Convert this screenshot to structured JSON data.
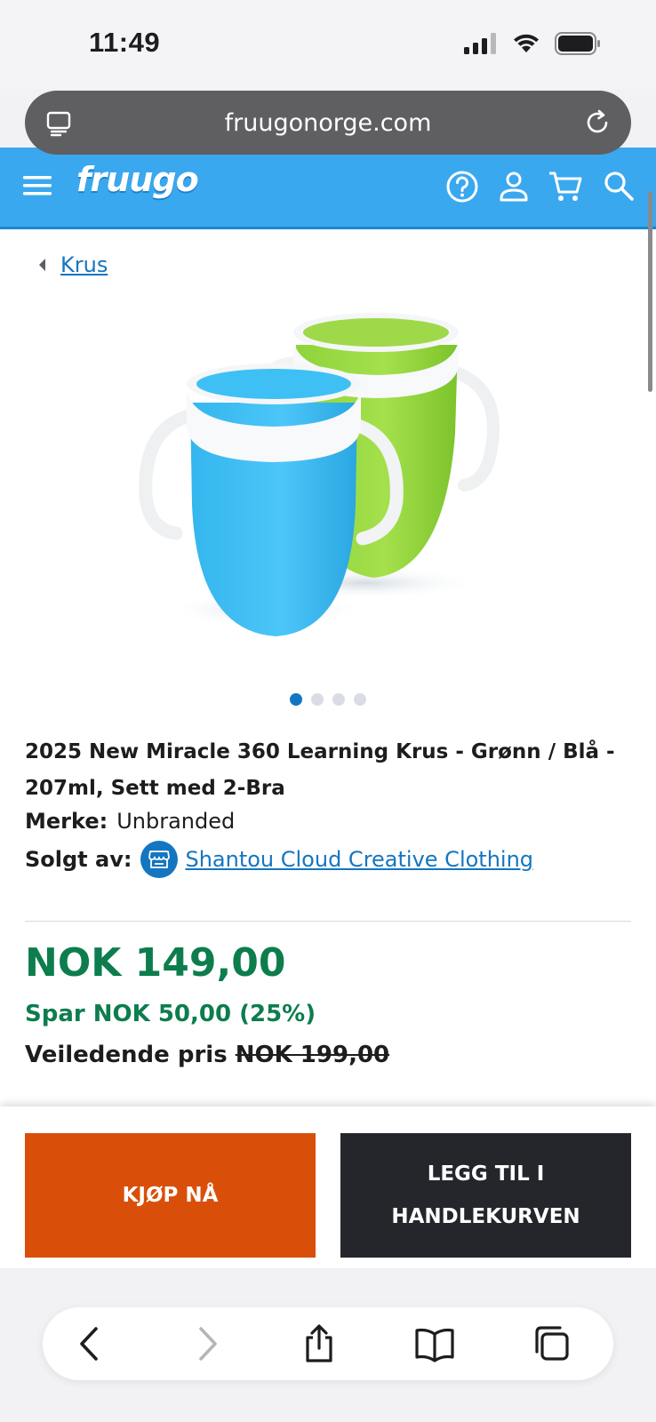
{
  "status_bar": {
    "time": "11:49"
  },
  "browser": {
    "url": "fruugonorge.com"
  },
  "header": {
    "logo_text": "fruugo",
    "icons": [
      "menu-icon",
      "help-icon",
      "account-icon",
      "cart-icon",
      "search-icon"
    ]
  },
  "breadcrumb": {
    "label": "Krus"
  },
  "gallery": {
    "image_count": 4,
    "active_index": 0
  },
  "product": {
    "title": "2025 New Miracle 360 Learning Krus - Grønn / Blå - 207ml, Sett med 2-Bra",
    "brand_label": "Merke:",
    "brand_value": "Unbranded",
    "seller_label": "Solgt av:",
    "seller_name": "Shantou Cloud Creative Clothing"
  },
  "pricing": {
    "price": "NOK 149,00",
    "savings": "Spar NOK 50,00 (25%)",
    "rrp_label": "Veiledende pris",
    "rrp_value": "NOK 199,00"
  },
  "actions": {
    "buy_now": "KJØP NÅ",
    "add_to_cart": "LEGG TIL I HANDLEKURVEN"
  },
  "toolbar": {
    "icons": [
      "back-icon",
      "forward-icon",
      "share-icon",
      "bookmarks-icon",
      "tabs-icon"
    ]
  },
  "colors": {
    "header_blue": "#3aa8ef",
    "link_blue": "#1476c0",
    "price_green": "#0d7d4d",
    "buy_orange": "#d94f0a",
    "cart_dark": "#24262b"
  }
}
